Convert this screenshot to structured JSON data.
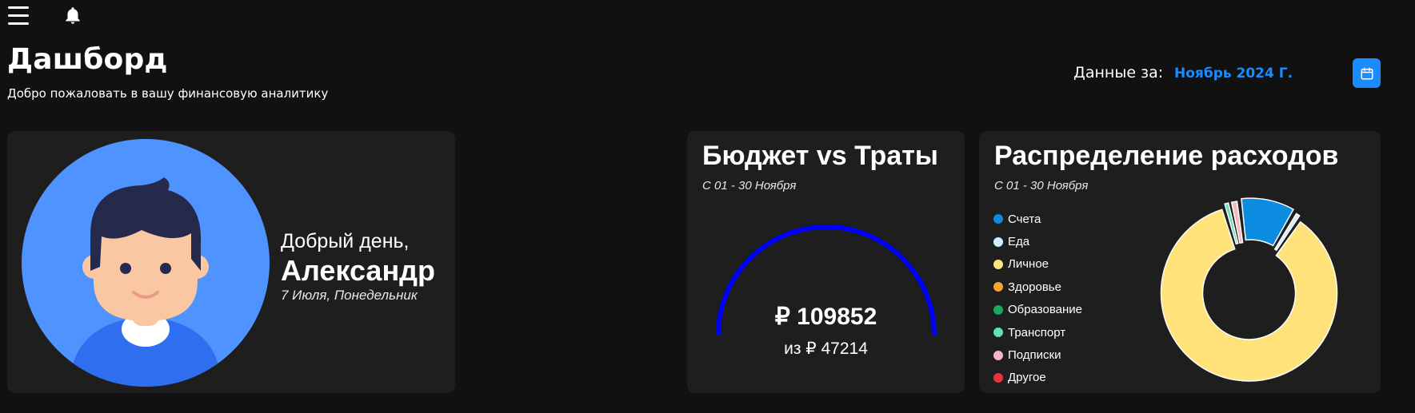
{
  "header": {
    "title": "Дашборд",
    "subtitle": "Добро пожаловать в вашу финансовую аналитику",
    "period_label": "Данные за:",
    "period_value": "Ноябрь 2024 Г."
  },
  "user_card": {
    "greeting": "Добрый день,",
    "name": "Александр",
    "date": "7 Июля, Понедельник"
  },
  "budget_card": {
    "title": "Бюджет vs Траты",
    "range": "С 01 - 30 Ноября",
    "spent": "₽ 109852",
    "total": "из ₽ 47214"
  },
  "distribution_card": {
    "title": "Распределение расходов",
    "range": "С 01 - 30 Ноября",
    "legend": [
      {
        "label": "Счета",
        "color": "#0b8ce0"
      },
      {
        "label": "Еда",
        "color": "#cdeefa"
      },
      {
        "label": "Личное",
        "color": "#ffe27a"
      },
      {
        "label": "Здоровье",
        "color": "#f4a534"
      },
      {
        "label": "Образование",
        "color": "#1aa85c"
      },
      {
        "label": "Транспорт",
        "color": "#5fe0b5"
      },
      {
        "label": "Подписки",
        "color": "#f7b8c2"
      },
      {
        "label": "Другое",
        "color": "#e8303f"
      }
    ]
  },
  "chart_data": {
    "type": "pie",
    "categories": [
      "Счета",
      "Еда",
      "Личное",
      "Здоровье",
      "Образование",
      "Транспорт",
      "Подписки",
      "Другое"
    ],
    "values": [
      10,
      1.2,
      83,
      0,
      0,
      1.2,
      1.5,
      0
    ],
    "colors": [
      "#0b8ce0",
      "#cdeefa",
      "#ffe27a",
      "#f4a534",
      "#1aa85c",
      "#5fe0b5",
      "#f7b8c2",
      "#e8303f"
    ],
    "donut": true,
    "title": "Распределение расходов"
  },
  "icons": {
    "menu": "hamburger-icon",
    "bell": "bell-icon",
    "calendar": "calendar-icon"
  }
}
